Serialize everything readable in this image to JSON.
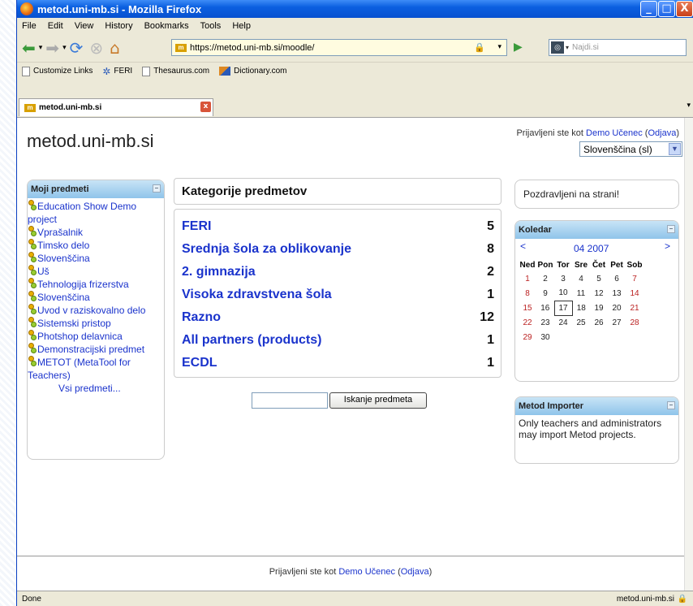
{
  "window": {
    "title": "metod.uni-mb.si - Mozilla Firefox",
    "min": "_",
    "max": "□",
    "close": "X"
  },
  "menu": [
    "File",
    "Edit",
    "View",
    "History",
    "Bookmarks",
    "Tools",
    "Help"
  ],
  "nav": {
    "url": "https://metod.uni-mb.si/moodle/",
    "search_placeholder": "Najdi.si"
  },
  "bookmarks": [
    "Customize Links",
    "FERI",
    "Thesaurus.com",
    "Dictionary.com"
  ],
  "tab": {
    "label": "metod.uni-mb.si"
  },
  "status": {
    "left": "Done",
    "right": "metod.uni-mb.si"
  },
  "header": {
    "site_name": "metod.uni-mb.si",
    "login_prefix": "Prijavljeni ste kot ",
    "user": "Demo Učenec",
    "logout": "Odjava",
    "language": "Slovenščina (sl)"
  },
  "my_courses": {
    "title": "Moji predmeti",
    "items": [
      "Education Show Demo project",
      "Vprašalnik",
      "Timsko delo",
      "Slovenščina",
      "Uš",
      "Tehnologija frizerstva",
      "Slovenščina",
      "Uvod v raziskovalno delo",
      "Sistemski pristop",
      "Photshop delavnica",
      "Demonstracijski predmet",
      "METOT (MetaTool for Teachers)"
    ],
    "all_link": "Vsi predmeti..."
  },
  "categories": {
    "title": "Kategorije predmetov",
    "rows": [
      {
        "name": "FERI",
        "count": "5"
      },
      {
        "name": "Srednja šola za oblikovanje",
        "count": "8"
      },
      {
        "name": "2. gimnazija",
        "count": "2"
      },
      {
        "name": "Visoka zdravstvena šola",
        "count": "1"
      },
      {
        "name": "Razno",
        "count": "12"
      },
      {
        "name": "All partners (products)",
        "count": "1"
      },
      {
        "name": "ECDL",
        "count": "1"
      }
    ],
    "search_button": "Iskanje predmeta"
  },
  "greeting": "Pozdravljeni na strani!",
  "calendar": {
    "title": "Koledar",
    "prev": "<",
    "next": ">",
    "month": "04 2007",
    "days": [
      "Ned",
      "Pon",
      "Tor",
      "Sre",
      "Čet",
      "Pet",
      "Sob"
    ],
    "weeks": [
      [
        "1",
        "2",
        "3",
        "4",
        "5",
        "6",
        "7"
      ],
      [
        "8",
        "9",
        "10",
        "11",
        "12",
        "13",
        "14"
      ],
      [
        "15",
        "16",
        "17",
        "18",
        "19",
        "20",
        "21"
      ],
      [
        "22",
        "23",
        "24",
        "25",
        "26",
        "27",
        "28"
      ],
      [
        "29",
        "30",
        "",
        "",
        "",
        "",
        ""
      ]
    ],
    "today": "17"
  },
  "importer": {
    "title": "Metod Importer",
    "text": "Only teachers and administrators may import Metod projects."
  },
  "footer": {
    "prefix": "Prijavljeni ste kot ",
    "user": "Demo Učenec",
    "logout": "Odjava"
  }
}
